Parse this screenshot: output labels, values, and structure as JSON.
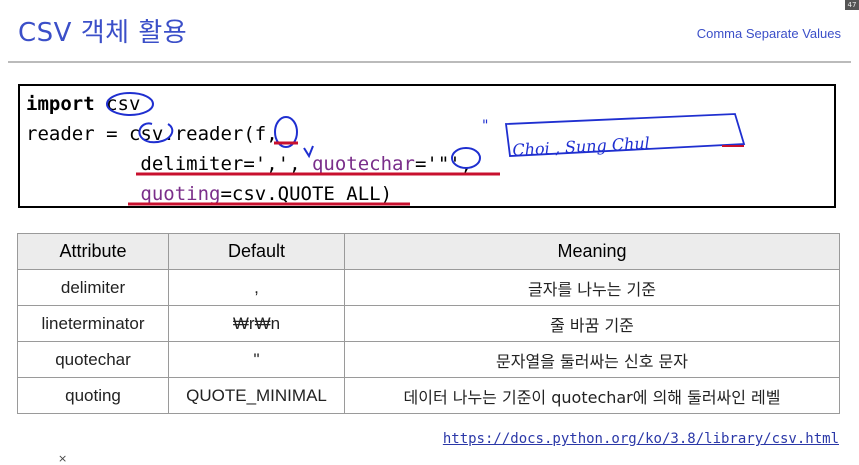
{
  "slide": {
    "title": "CSV 객체 활용",
    "subtitle": "Comma Separate Values",
    "badge": "47",
    "link": "https://docs.python.org/ko/3.8/library/csv.html",
    "cursor": "×"
  },
  "code": {
    "line1": {
      "kw": "import",
      "rest": " csv"
    },
    "line2": "reader = csv.reader(f,",
    "line3": {
      "a": "          delimiter=',', ",
      "b": "quotechar",
      "c": "='\"',"
    },
    "line4": {
      "a": "          ",
      "b": "quoting",
      "c": "=csv.QUOTE_ALL)"
    },
    "handwriting": "Choi , Sung Chul"
  },
  "table": {
    "headers": [
      "Attribute",
      "Default",
      "Meaning"
    ],
    "rows": [
      [
        "delimiter",
        ",",
        "글자를 나누는 기준"
      ],
      [
        "lineterminator",
        "₩r₩n",
        "줄 바꿈 기준"
      ],
      [
        "quotechar",
        "\"",
        "문자열을 둘러싸는 신호 문자"
      ],
      [
        "quoting",
        "QUOTE_MINIMAL",
        "데이터 나누는 기준이 quotechar에 의해 둘러싸인 레벨"
      ]
    ]
  },
  "colors": {
    "title": "#3b4fc8",
    "annotation_blue": "#1f2fd0",
    "annotation_red": "#c8102e",
    "keyword_purple": "#7a2e8a"
  }
}
